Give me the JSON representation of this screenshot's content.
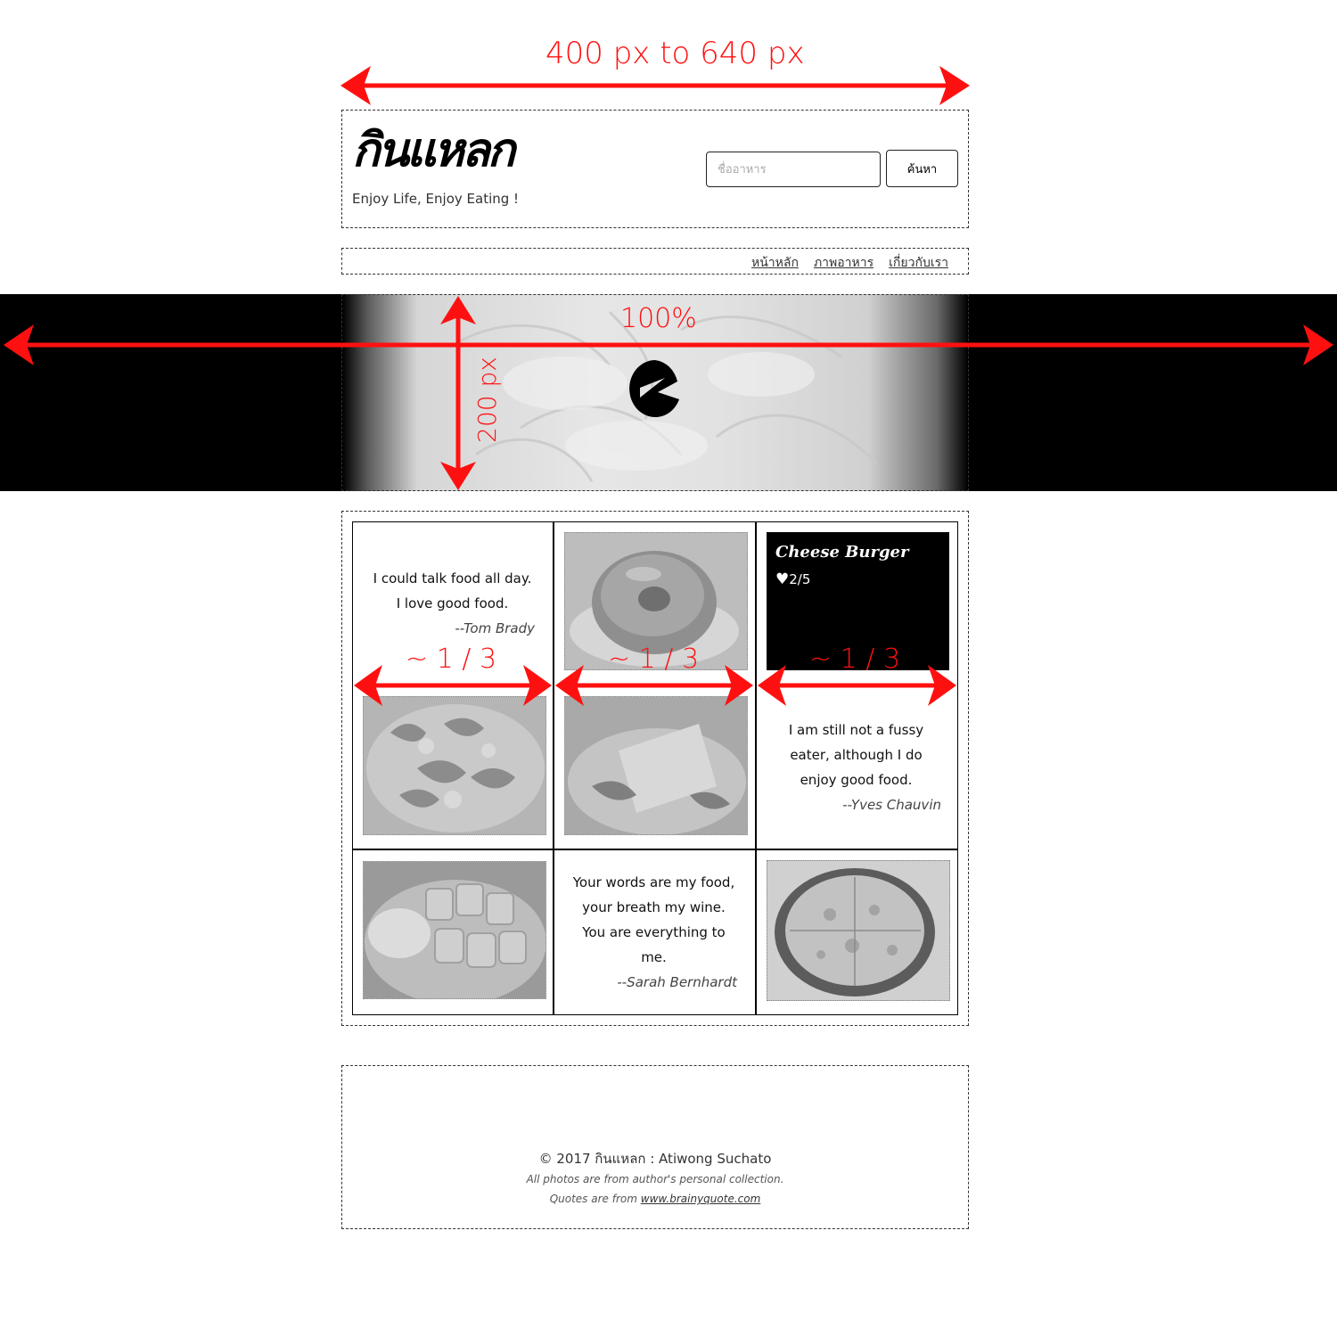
{
  "annotations": {
    "container_width": "400 px to 640 px",
    "hero_width": "100%",
    "hero_height": "200 px",
    "column_fraction": "~ 1 / 3",
    "color": "#ff1010"
  },
  "header": {
    "logo": "กินแหลก",
    "tagline": "Enjoy Life, Enjoy Eating !",
    "search_placeholder": "ชื่ออาหาร",
    "search_button": "ค้นหา"
  },
  "nav": {
    "items": [
      {
        "label": "หน้าหลัก"
      },
      {
        "label": "ภาพอาหาร"
      },
      {
        "label": "เกี่ยวกับเรา"
      }
    ]
  },
  "hero": {
    "logo_icon": "e-mark-icon",
    "band_color": "#000000"
  },
  "gallery": {
    "quote1": {
      "lines": [
        "I could talk food all day.",
        "I love good food."
      ],
      "author": "--Tom Brady"
    },
    "quote2": {
      "lines": [
        "I am still not a fussy",
        "eater, although I do",
        "enjoy good food."
      ],
      "author": "--Yves Chauvin"
    },
    "quote3": {
      "lines": [
        "Your words are my food,",
        "your breath my wine.",
        "You are everything to",
        "me."
      ],
      "author": "--Sarah Bernhardt"
    },
    "featured": {
      "title": "Cheese Burger",
      "likes": "2/5"
    },
    "photos": [
      "donut",
      "fried-dish",
      "crepe-plate",
      "mango-sticky-rice",
      "pizza"
    ]
  },
  "footer": {
    "copyright": "© 2017 กินแหลก : Atiwong Suchato",
    "photos_note": "All photos are from author's personal collection.",
    "quotes_prefix": "Quotes are from ",
    "quotes_link": "www.brainyquote.com"
  }
}
